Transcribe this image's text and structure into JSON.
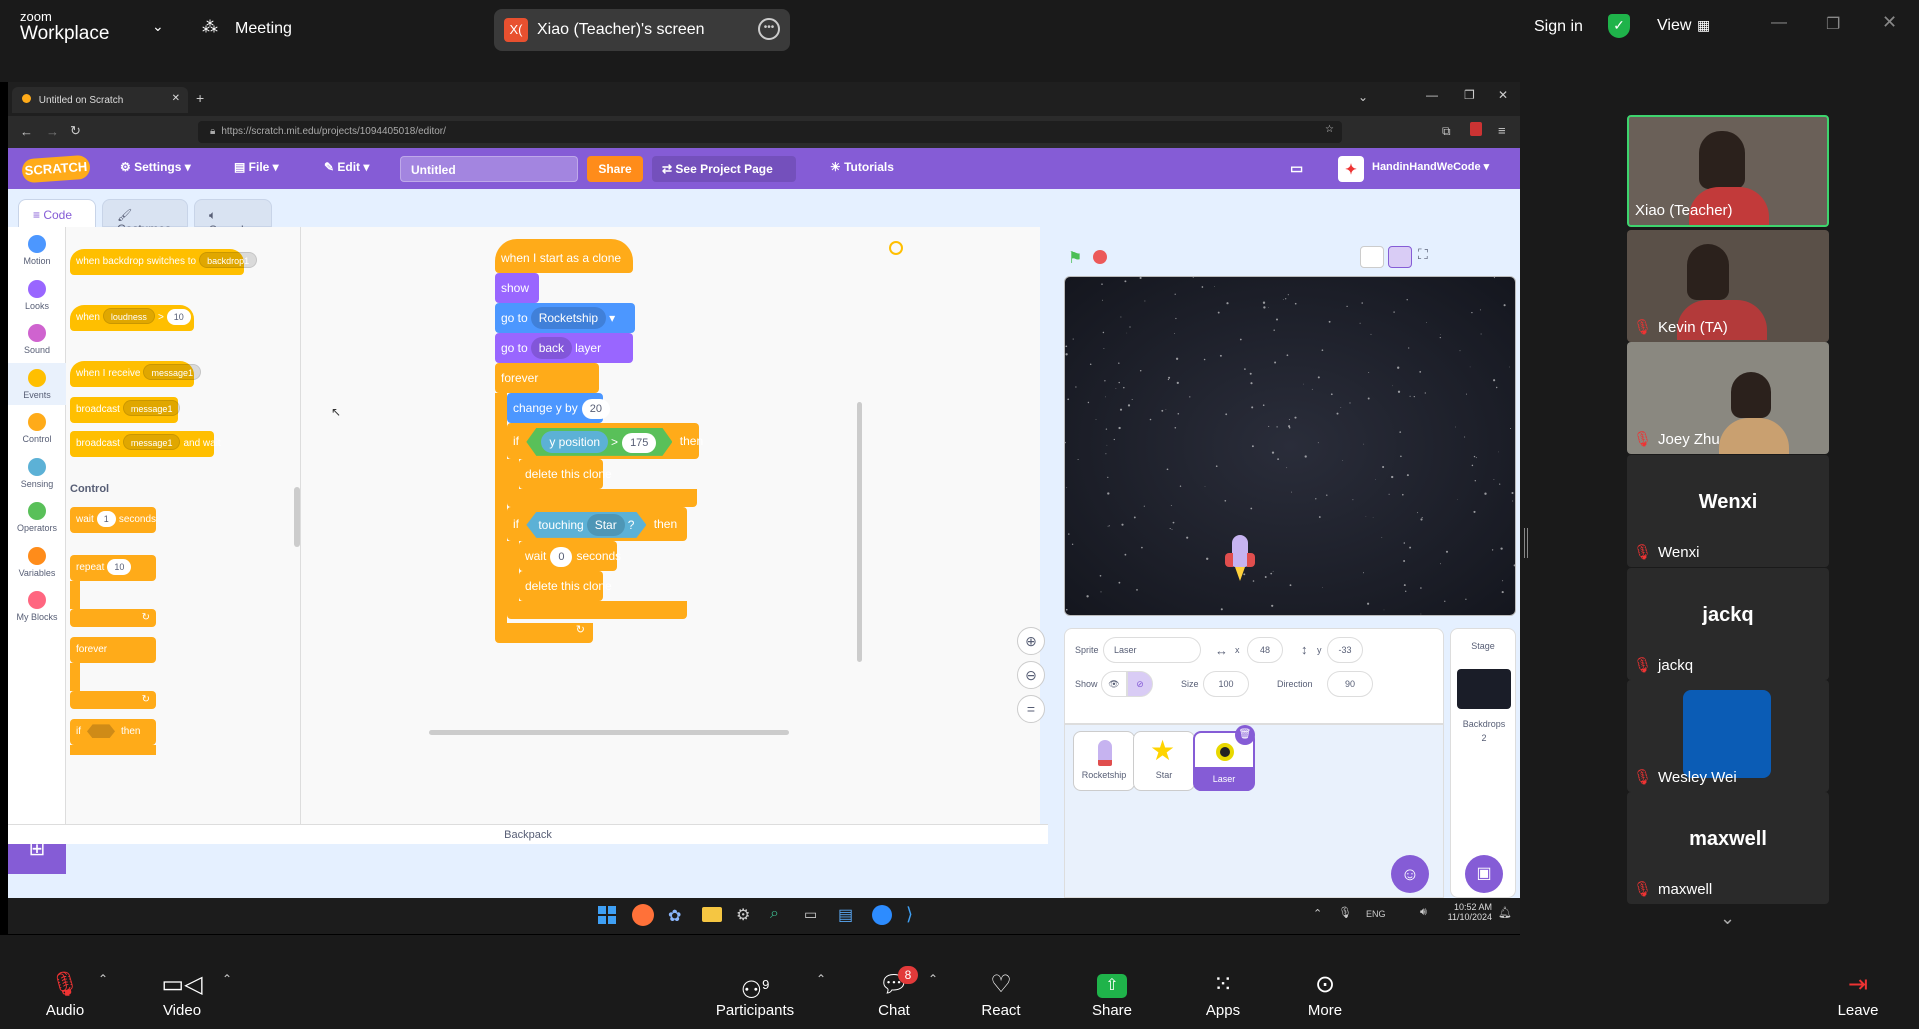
{
  "zoom": {
    "brand_line1": "zoom",
    "brand_line2": "Workplace",
    "meeting_label": "Meeting",
    "screen_share_badge": "X(",
    "screen_share_label": "Xiao (Teacher)'s screen",
    "sign_in": "Sign in",
    "view": "View",
    "accent_green": "#2d8c3c"
  },
  "browser": {
    "tab_title": "Untitled on Scratch",
    "url": "https://scratch.mit.edu/projects/1094405018/editor/"
  },
  "scratch": {
    "logo": "SCRATCH",
    "menu": {
      "settings": "Settings",
      "file": "File",
      "edit": "Edit",
      "share": "Share",
      "see_project": "See Project Page",
      "tutorials": "Tutorials",
      "user": "HandinHandWeCode"
    },
    "project_title": "Untitled",
    "tabs": {
      "code": "Code",
      "costumes": "Costumes",
      "sounds": "Sounds"
    },
    "categories": [
      {
        "label": "Motion",
        "color": "#4c97ff"
      },
      {
        "label": "Looks",
        "color": "#9966ff"
      },
      {
        "label": "Sound",
        "color": "#cf63cf"
      },
      {
        "label": "Events",
        "color": "#ffbf00"
      },
      {
        "label": "Control",
        "color": "#ffab19"
      },
      {
        "label": "Sensing",
        "color": "#5cb1d6"
      },
      {
        "label": "Operators",
        "color": "#59c059"
      },
      {
        "label": "Variables",
        "color": "#ff8c1a"
      },
      {
        "label": "My Blocks",
        "color": "#ff6680"
      }
    ],
    "palette": {
      "backdrop_switch": "when backdrop switches to",
      "backdrop_value": "backdrop1",
      "when": "when",
      "loudness": "loudness",
      "gt": ">",
      "loudness_value": "10",
      "when_receive": "when I receive",
      "message1": "message1",
      "broadcast": "broadcast",
      "and_wait": "and wait",
      "control_heading": "Control",
      "wait": "wait",
      "wait_value": "1",
      "seconds": "seconds",
      "repeat": "repeat",
      "repeat_value": "10",
      "forever": "forever",
      "if": "if",
      "then": "then"
    },
    "script": {
      "hat": "when I start as a clone",
      "show": "show",
      "goto": "go to",
      "goto_target": "Rocketship",
      "goto_layer": "go to",
      "layer_value": "back",
      "layer": "layer",
      "forever": "forever",
      "change_y": "change y by",
      "change_value": "20",
      "if1": "if",
      "y_position": "y position",
      "gt": ">",
      "y_limit": "175",
      "then1": "then",
      "delete1": "delete this clone",
      "if2": "if",
      "touching": "touching",
      "touch_target": "Star",
      "q": "?",
      "then2": "then",
      "wait": "wait",
      "wait_value": "0",
      "seconds": "seconds",
      "delete2": "delete this clone"
    },
    "backpack": "Backpack",
    "sprite_info": {
      "sprite_label": "Sprite",
      "sprite_name": "Laser",
      "x_label": "x",
      "x": "48",
      "y_label": "y",
      "y": "-33",
      "show_label": "Show",
      "size_label": "Size",
      "size": "100",
      "direction_label": "Direction",
      "direction": "90"
    },
    "sprites": [
      "Rocketship",
      "Star",
      "Laser"
    ],
    "stage_pane": {
      "label": "Stage",
      "backdrops_label": "Backdrops",
      "backdrops_count": "2"
    }
  },
  "taskbar": {
    "lang": "ENG",
    "time": "10:52 AM",
    "date": "11/10/2024"
  },
  "participants": [
    {
      "name": "Xiao (Teacher)",
      "type": "video"
    },
    {
      "name": "Kevin (TA)",
      "type": "video"
    },
    {
      "name": "Joey Zhu",
      "type": "video"
    },
    {
      "big": "Wenxi",
      "name": "Wenxi",
      "type": "name"
    },
    {
      "big": "jackq",
      "name": "jackq",
      "type": "name"
    },
    {
      "name": "Wesley Wei",
      "type": "avatar"
    },
    {
      "big": "maxwell",
      "name": "maxwell",
      "type": "name"
    }
  ],
  "toolbar": {
    "audio": "Audio",
    "video": "Video",
    "participants": "Participants",
    "participants_count": "9",
    "chat": "Chat",
    "chat_badge": "8",
    "react": "React",
    "share": "Share",
    "apps": "Apps",
    "more": "More",
    "leave": "Leave"
  }
}
